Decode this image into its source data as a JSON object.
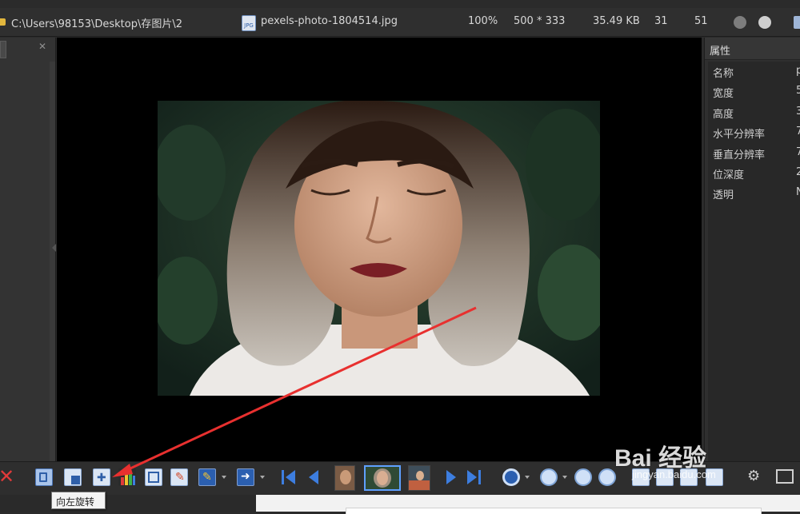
{
  "topbar": {
    "path": "C:\\Users\\98153\\Desktop\\存图片\\2",
    "filename": "pexels-photo-1804514.jpg",
    "file_icon_label": "JPG",
    "zoom": "100%",
    "dimensions": "500 * 333",
    "filesize": "35.49 KB",
    "num1": "31",
    "num2": "51"
  },
  "properties": {
    "title": "属性",
    "rows": [
      {
        "key": "名称",
        "value": "p"
      },
      {
        "key": "宽度",
        "value": "5"
      },
      {
        "key": "高度",
        "value": "3"
      },
      {
        "key": "水平分辨率",
        "value": "7"
      },
      {
        "key": "垂直分辨率",
        "value": "7"
      },
      {
        "key": "位深度",
        "value": "2"
      },
      {
        "key": "透明",
        "value": "N"
      }
    ]
  },
  "tooltip": {
    "text": "向左旋转"
  },
  "watermark": {
    "logo": "Bai 经验",
    "url": "jingyan.baidu.com"
  },
  "colors": {
    "accent_blue": "#3d7ee0",
    "annotation_red": "#e8302f",
    "delete_red": "#e23a3a",
    "background": "#2b2b2b"
  },
  "icons": {
    "delete": "close-x-icon",
    "rotate_left": "rotate-left-icon",
    "first": "skip-first-icon",
    "prev": "previous-icon",
    "next": "next-icon",
    "last": "skip-last-icon",
    "settings": "gear-icon",
    "zoom_in": "zoom-in-icon",
    "zoom_out": "zoom-out-icon"
  }
}
